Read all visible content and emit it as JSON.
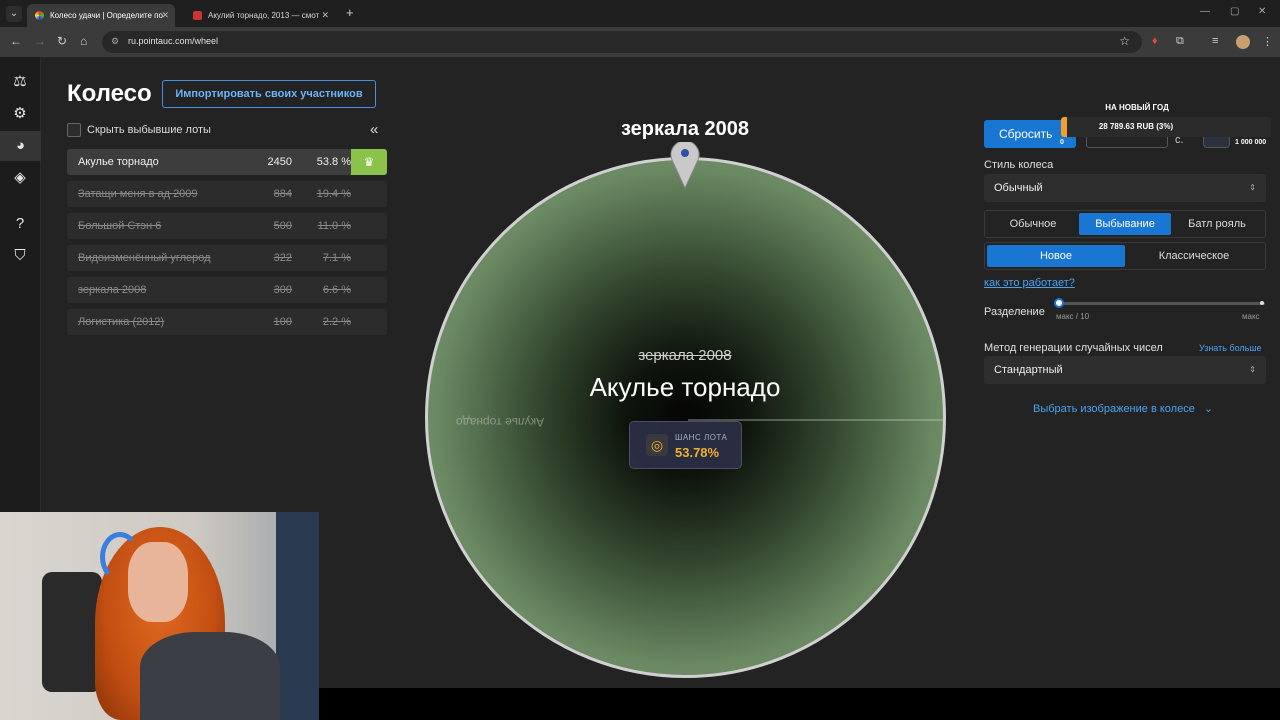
{
  "browser": {
    "tabs": [
      {
        "title": "Колесо удачи | Определите по",
        "active": true
      },
      {
        "title": "Акулий торнадо, 2013 — смот",
        "active": false
      }
    ],
    "url": "ru.pointauc.com/wheel"
  },
  "header": {
    "title": "Колесо",
    "import_label": "Импортировать своих участников"
  },
  "lots_panel": {
    "hide_label": "Скрыть выбывшие лоты",
    "lots": [
      {
        "name": "Акулье торнадо",
        "amount": "2450",
        "percent": "53.8 %",
        "status": "winner"
      },
      {
        "name": "Затащи меня в ад 2009",
        "amount": "884",
        "percent": "19.4 %",
        "status": "eliminated"
      },
      {
        "name": "Большой Стэн 6",
        "amount": "500",
        "percent": "11.0 %",
        "status": "eliminated"
      },
      {
        "name": "Видоизменённый углерод",
        "amount": "322",
        "percent": "7.1 %",
        "status": "eliminated"
      },
      {
        "name": "зеркала 2008",
        "amount": "300",
        "percent": "6.6 %",
        "status": "eliminated"
      },
      {
        "name": "Логистика (2012)",
        "amount": "100",
        "percent": "2.2 %",
        "status": "eliminated"
      }
    ]
  },
  "wheel": {
    "pointer_label": "зеркала 2008",
    "eliminated_label": "зеркала 2008",
    "winner_label": "Акулье торнадо",
    "segment_text": "Акулье торнадо",
    "chance_label": "ШАНС ЛОТА",
    "chance_value": "53.78%",
    "colors": {
      "segment": "#87a67e",
      "rim": "#d0d0d0"
    }
  },
  "controls": {
    "reset_label": "Сбросить",
    "seconds_unit": "с.",
    "wheel_style_label": "Стиль колеса",
    "wheel_style_value": "Обычный",
    "mode_tabs": [
      "Обычное",
      "Выбывание",
      "Батл рояль"
    ],
    "mode_selected": "Выбывание",
    "variant_tabs": [
      "Новое",
      "Классическое"
    ],
    "variant_selected": "Новое",
    "how_link": "как это работает?",
    "split_label": "Разделение",
    "split_min_label": "макс / 10",
    "split_max_label": "макс",
    "rng_label": "Метод генерации случайных чисел",
    "rng_more": "Узнать больше",
    "rng_value": "Стандартный",
    "image_pick": "Выбрать изображение в колесе"
  },
  "donation_overlay": {
    "title": "НА НОВЫЙ ГОД",
    "amount_text": "28 789.63 RUB (3%)",
    "progress": 0.03,
    "min_label": "0",
    "max_label": "1 000 000"
  }
}
